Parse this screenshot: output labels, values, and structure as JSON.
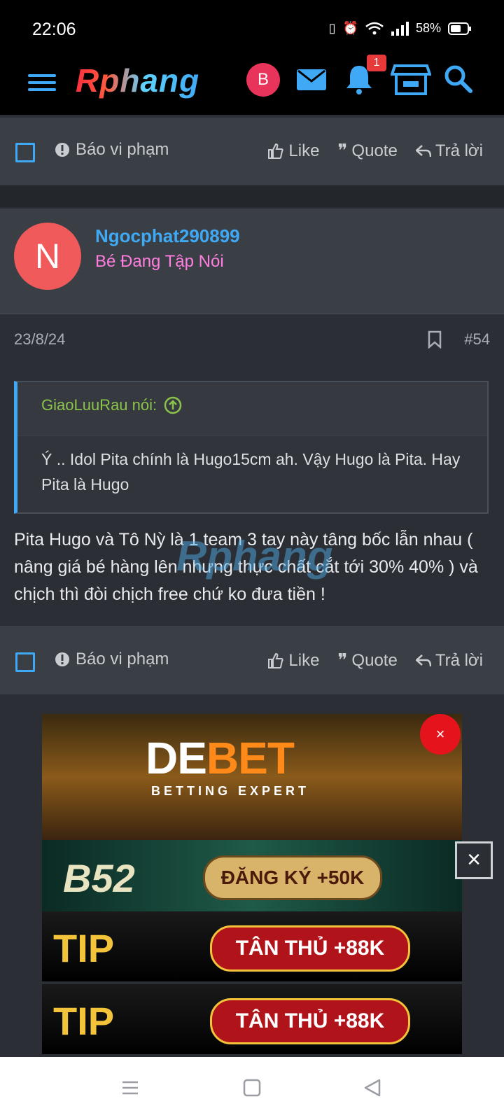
{
  "status": {
    "time": "22:06",
    "battery": "58%"
  },
  "app": {
    "logo": "Rphang",
    "avatar_letter": "B",
    "notification_count": "1"
  },
  "actions": {
    "report": "Báo vi phạm",
    "like": "Like",
    "quote": "Quote",
    "reply": "Trả lời"
  },
  "post": {
    "avatar_letter": "N",
    "username": "Ngocphat290899",
    "user_title": "Bé Đang Tập Nói",
    "date": "23/8/24",
    "number": "#54",
    "quote_author": "GiaoLuuRau nói:",
    "quote_text": "Ý .. Idol Pita chính là Hugo15cm ah. Vậy Hugo là Pita. Hay Pita là Hugo",
    "body": "Pita Hugo và Tô Nỳ là 1 team 3 tay này tâng bốc lẫn nhau ( nâng giá bé hàng lên nhưng thực chất cắt tới 30% 40% ) và chịch thì đòi chịch free chứ ko đưa tiền !"
  },
  "ads": {
    "debet_title_a": "DE",
    "debet_title_b": "BET",
    "debet_sub": "BETTING EXPERT",
    "b52_logo": "B52",
    "b52_cta": "ĐĂNG KÝ +50K",
    "tip_logo": "TIP",
    "tip_cta": "TÂN THỦ +88K",
    "close_symbol": "×"
  }
}
